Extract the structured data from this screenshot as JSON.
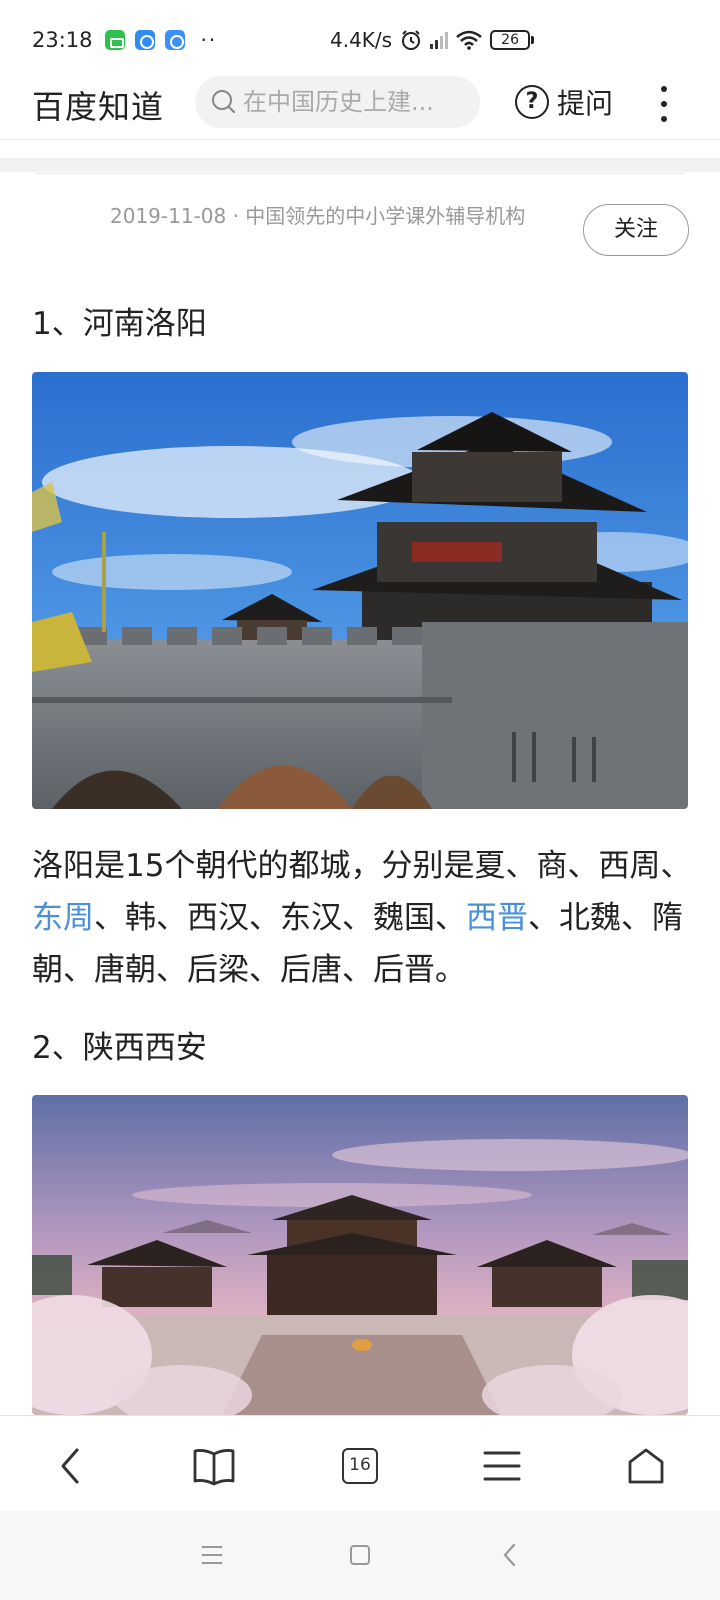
{
  "status_bar": {
    "time": "23:18",
    "more_indicator": "··",
    "network_speed": "4.4K/s",
    "battery_level": "26",
    "icons": [
      "wechat-app-icon",
      "browser-app-icon",
      "qq-app-icon",
      "alarm-icon",
      "signal-icon",
      "wifi-icon",
      "battery-icon"
    ]
  },
  "header": {
    "brand": "百度知道",
    "search_placeholder": "在中国历史上建...",
    "ask_label": "提问",
    "ask_icon_glyph": "?"
  },
  "article": {
    "meta": "2019-11-08 · 中国领先的中小学课外辅导机构",
    "follow_label": "关注",
    "section1_title": "1、河南洛阳",
    "paragraph": {
      "part1": "洛阳是15个朝代的都城，分别是夏、商、西周、",
      "link1": "东周",
      "part2": "、韩、西汉、东汉、魏国、",
      "link2": "西晋",
      "part3": "、北魏、隋朝、唐朝、后梁、后唐、后晋。"
    },
    "section2_title": "2、陕西西安"
  },
  "toolbar": {
    "tab_count": "16",
    "icons": [
      "back-icon",
      "bookmarks-icon",
      "tabs-icon",
      "menu-icon",
      "home-icon"
    ]
  },
  "colors": {
    "link": "#4a90d9",
    "text": "#222222",
    "meta": "#999999"
  }
}
